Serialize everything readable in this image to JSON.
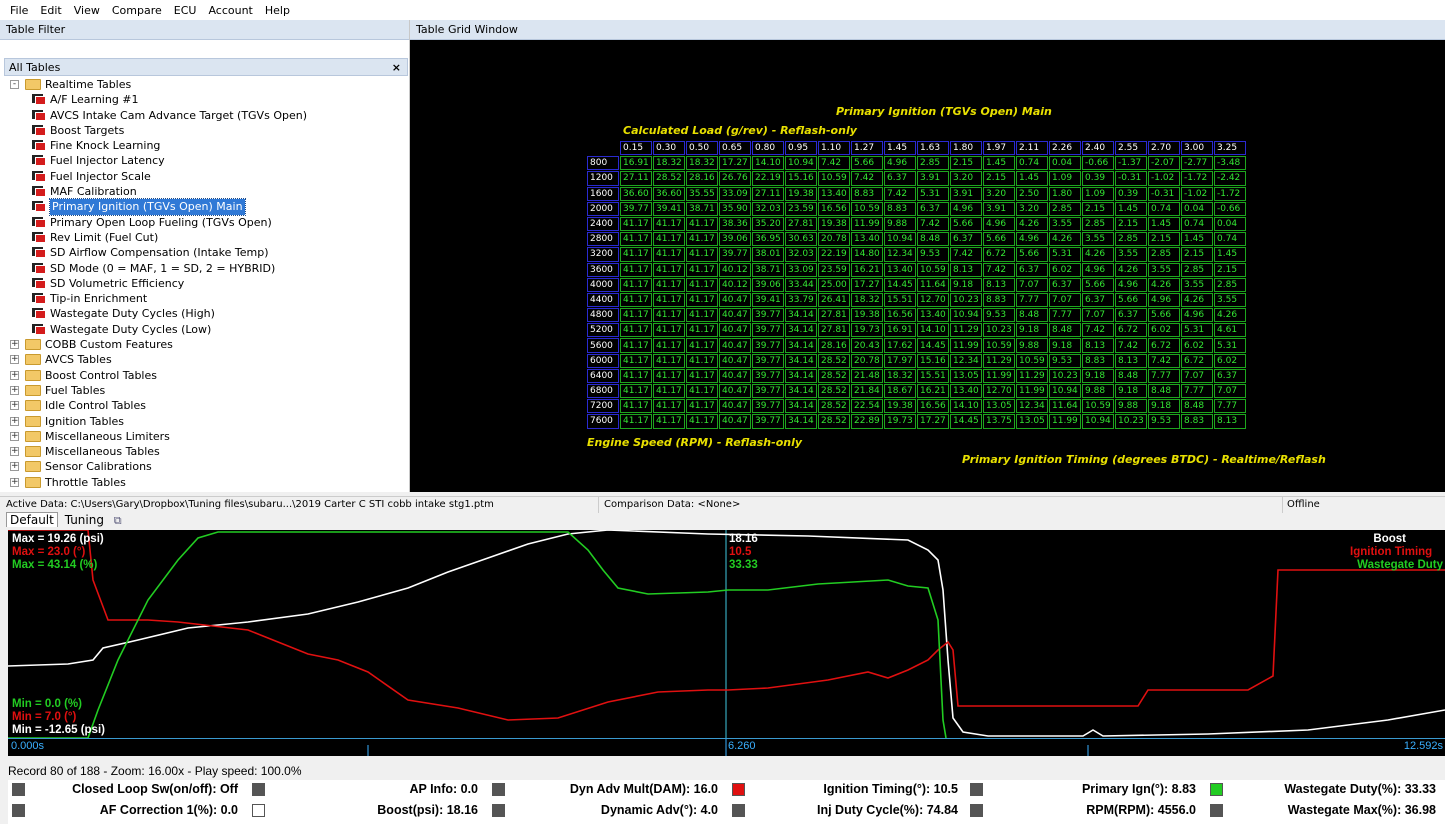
{
  "menu": [
    "File",
    "Edit",
    "View",
    "Compare",
    "ECU",
    "Account",
    "Help"
  ],
  "left_panel": {
    "header": "Table Filter",
    "filter_value": "",
    "all_tables_label": "All Tables",
    "close_symbol": "×"
  },
  "tree": {
    "root_folder": "Realtime Tables",
    "realtime_items": [
      "A/F Learning #1",
      "AVCS Intake Cam Advance Target (TGVs Open)",
      "Boost Targets",
      "Fine Knock Learning",
      "Fuel Injector Latency",
      "Fuel Injector Scale",
      "MAF Calibration",
      "Primary Ignition (TGVs Open) Main",
      "Primary Open Loop Fueling (TGVs Open)",
      "Rev Limit (Fuel Cut)",
      "SD Airflow Compensation (Intake Temp)",
      "SD Mode (0 = MAF, 1 = SD, 2 = HYBRID)",
      "SD Volumetric Efficiency",
      "Tip-in Enrichment",
      "Wastegate Duty Cycles (High)",
      "Wastegate Duty Cycles (Low)"
    ],
    "selected_item": "Primary Ignition (TGVs Open) Main",
    "other_folders": [
      "COBB Custom Features",
      "AVCS Tables",
      "Boost Control Tables",
      "Fuel Tables",
      "Idle Control Tables",
      "Ignition Tables",
      "Miscellaneous Limiters",
      "Miscellaneous Tables",
      "Sensor Calibrations",
      "Throttle Tables"
    ]
  },
  "grid_window": {
    "header": "Table Grid Window",
    "title": "Primary Ignition (TGVs Open) Main",
    "x_axis_label": "Calculated Load (g/rev) - Reflash-only",
    "y_axis_label": "Engine Speed (RPM) - Reflash-only",
    "z_label": "Primary Ignition Timing (degrees BTDC) - Realtime/Reflash",
    "x_headers": [
      "0.15",
      "0.30",
      "0.50",
      "0.65",
      "0.80",
      "0.95",
      "1.10",
      "1.27",
      "1.45",
      "1.63",
      "1.80",
      "1.97",
      "2.11",
      "2.26",
      "2.40",
      "2.55",
      "2.70",
      "3.00",
      "3.25"
    ],
    "rows": [
      {
        "rpm": "800",
        "values": [
          "16.91",
          "18.32",
          "18.32",
          "17.27",
          "14.10",
          "10.94",
          "7.42",
          "5.66",
          "4.96",
          "2.85",
          "2.15",
          "1.45",
          "0.74",
          "0.04",
          "-0.66",
          "-1.37",
          "-2.07",
          "-2.77",
          "-3.48"
        ]
      },
      {
        "rpm": "1200",
        "values": [
          "27.11",
          "28.52",
          "28.16",
          "26.76",
          "22.19",
          "15.16",
          "10.59",
          "7.42",
          "6.37",
          "3.91",
          "3.20",
          "2.15",
          "1.45",
          "1.09",
          "0.39",
          "-0.31",
          "-1.02",
          "-1.72",
          "-2.42"
        ]
      },
      {
        "rpm": "1600",
        "values": [
          "36.60",
          "36.60",
          "35.55",
          "33.09",
          "27.11",
          "19.38",
          "13.40",
          "8.83",
          "7.42",
          "5.31",
          "3.91",
          "3.20",
          "2.50",
          "1.80",
          "1.09",
          "0.39",
          "-0.31",
          "-1.02",
          "-1.72"
        ]
      },
      {
        "rpm": "2000",
        "values": [
          "39.77",
          "39.41",
          "38.71",
          "35.90",
          "32.03",
          "23.59",
          "16.56",
          "10.59",
          "8.83",
          "6.37",
          "4.96",
          "3.91",
          "3.20",
          "2.85",
          "2.15",
          "1.45",
          "0.74",
          "0.04",
          "-0.66"
        ]
      },
      {
        "rpm": "2400",
        "values": [
          "41.17",
          "41.17",
          "41.17",
          "38.36",
          "35.20",
          "27.81",
          "19.38",
          "11.99",
          "9.88",
          "7.42",
          "5.66",
          "4.96",
          "4.26",
          "3.55",
          "2.85",
          "2.15",
          "1.45",
          "0.74",
          "0.04"
        ]
      },
      {
        "rpm": "2800",
        "values": [
          "41.17",
          "41.17",
          "41.17",
          "39.06",
          "36.95",
          "30.63",
          "20.78",
          "13.40",
          "10.94",
          "8.48",
          "6.37",
          "5.66",
          "4.96",
          "4.26",
          "3.55",
          "2.85",
          "2.15",
          "1.45",
          "0.74"
        ]
      },
      {
        "rpm": "3200",
        "values": [
          "41.17",
          "41.17",
          "41.17",
          "39.77",
          "38.01",
          "32.03",
          "22.19",
          "14.80",
          "12.34",
          "9.53",
          "7.42",
          "6.72",
          "5.66",
          "5.31",
          "4.26",
          "3.55",
          "2.85",
          "2.15",
          "1.45"
        ]
      },
      {
        "rpm": "3600",
        "values": [
          "41.17",
          "41.17",
          "41.17",
          "40.12",
          "38.71",
          "33.09",
          "23.59",
          "16.21",
          "13.40",
          "10.59",
          "8.13",
          "7.42",
          "6.37",
          "6.02",
          "4.96",
          "4.26",
          "3.55",
          "2.85",
          "2.15"
        ]
      },
      {
        "rpm": "4000",
        "values": [
          "41.17",
          "41.17",
          "41.17",
          "40.12",
          "39.06",
          "33.44",
          "25.00",
          "17.27",
          "14.45",
          "11.64",
          "9.18",
          "8.13",
          "7.07",
          "6.37",
          "5.66",
          "4.96",
          "4.26",
          "3.55",
          "2.85"
        ]
      },
      {
        "rpm": "4400",
        "values": [
          "41.17",
          "41.17",
          "41.17",
          "40.47",
          "39.41",
          "33.79",
          "26.41",
          "18.32",
          "15.51",
          "12.70",
          "10.23",
          "8.83",
          "7.77",
          "7.07",
          "6.37",
          "5.66",
          "4.96",
          "4.26",
          "3.55"
        ]
      },
      {
        "rpm": "4800",
        "values": [
          "41.17",
          "41.17",
          "41.17",
          "40.47",
          "39.77",
          "34.14",
          "27.81",
          "19.38",
          "16.56",
          "13.40",
          "10.94",
          "9.53",
          "8.48",
          "7.77",
          "7.07",
          "6.37",
          "5.66",
          "4.96",
          "4.26"
        ]
      },
      {
        "rpm": "5200",
        "values": [
          "41.17",
          "41.17",
          "41.17",
          "40.47",
          "39.77",
          "34.14",
          "27.81",
          "19.73",
          "16.91",
          "14.10",
          "11.29",
          "10.23",
          "9.18",
          "8.48",
          "7.42",
          "6.72",
          "6.02",
          "5.31",
          "4.61"
        ]
      },
      {
        "rpm": "5600",
        "values": [
          "41.17",
          "41.17",
          "41.17",
          "40.47",
          "39.77",
          "34.14",
          "28.16",
          "20.43",
          "17.62",
          "14.45",
          "11.99",
          "10.59",
          "9.88",
          "9.18",
          "8.13",
          "7.42",
          "6.72",
          "6.02",
          "5.31"
        ]
      },
      {
        "rpm": "6000",
        "values": [
          "41.17",
          "41.17",
          "41.17",
          "40.47",
          "39.77",
          "34.14",
          "28.52",
          "20.78",
          "17.97",
          "15.16",
          "12.34",
          "11.29",
          "10.59",
          "9.53",
          "8.83",
          "8.13",
          "7.42",
          "6.72",
          "6.02"
        ]
      },
      {
        "rpm": "6400",
        "values": [
          "41.17",
          "41.17",
          "41.17",
          "40.47",
          "39.77",
          "34.14",
          "28.52",
          "21.48",
          "18.32",
          "15.51",
          "13.05",
          "11.99",
          "11.29",
          "10.23",
          "9.18",
          "8.48",
          "7.77",
          "7.07",
          "6.37"
        ]
      },
      {
        "rpm": "6800",
        "values": [
          "41.17",
          "41.17",
          "41.17",
          "40.47",
          "39.77",
          "34.14",
          "28.52",
          "21.84",
          "18.67",
          "16.21",
          "13.40",
          "12.70",
          "11.99",
          "10.94",
          "9.88",
          "9.18",
          "8.48",
          "7.77",
          "7.07"
        ]
      },
      {
        "rpm": "7200",
        "values": [
          "41.17",
          "41.17",
          "41.17",
          "40.47",
          "39.77",
          "34.14",
          "28.52",
          "22.54",
          "19.38",
          "16.56",
          "14.10",
          "13.05",
          "12.34",
          "11.64",
          "10.59",
          "9.88",
          "9.18",
          "8.48",
          "7.77"
        ]
      },
      {
        "rpm": "7600",
        "values": [
          "41.17",
          "41.17",
          "41.17",
          "40.47",
          "39.77",
          "34.14",
          "28.52",
          "22.89",
          "19.73",
          "17.27",
          "14.45",
          "13.75",
          "13.05",
          "11.99",
          "10.94",
          "10.23",
          "9.53",
          "8.83",
          "8.13"
        ]
      }
    ]
  },
  "status": {
    "active_data": "Active Data: C:\\Users\\Gary\\Dropbox\\Tuning files\\subaru...\\2019 Carter C STI cobb intake stg1.ptm",
    "comparison": "Comparison Data: <None>",
    "connection": "Offline"
  },
  "log_tabs": [
    "Default",
    "Tuning"
  ],
  "log_chart": {
    "max_boost": "Max = 19.26 (psi)",
    "max_ign": "Max = 23.0 (°)",
    "max_wg": "Max = 43.14 (%)",
    "min_wg": "Min = 0.0 (%)",
    "min_ign": "Min = 7.0 (°)",
    "min_boost": "Min = -12.65 (psi)",
    "cursor_boost": "18.16",
    "cursor_ign": "10.5",
    "cursor_wg": "33.33",
    "legend_boost": "Boost",
    "legend_ign": "Ignition Timing",
    "legend_wg": "Wastegate Duty",
    "time_start": "0.000s",
    "time_cursor": "6.260",
    "time_end": "12.592s",
    "colors": {
      "boost": "#ffffff",
      "ign": "#e01010",
      "wg": "#22cc22",
      "cursor": "#40c8e0"
    }
  },
  "record_line": "Record 80 of 188 - Zoom: 16.00x - Play speed: 100.0%",
  "params": [
    {
      "label": "Closed Loop Sw(on/off): Off",
      "color": "#555555"
    },
    {
      "label": "AP Info: 0.0",
      "color": "#555555"
    },
    {
      "label": "Dyn Adv Mult(DAM): 16.0",
      "color": "#555555"
    },
    {
      "label": "Ignition Timing(°): 10.5",
      "color": "#e01010"
    },
    {
      "label": "Primary Ign(°): 8.83",
      "color": "#555555"
    },
    {
      "label": "Wastegate Duty(%): 33.33",
      "color": "#22cc22"
    },
    {
      "label": "AF Correction 1(%): 0.0",
      "color": "#555555"
    },
    {
      "label": "Boost(psi): 18.16",
      "color": "#ffffff"
    },
    {
      "label": "Dynamic Adv(°): 4.0",
      "color": "#555555"
    },
    {
      "label": "Inj Duty Cycle(%): 74.84",
      "color": "#555555"
    },
    {
      "label": "RPM(RPM): 4556.0",
      "color": "#555555"
    },
    {
      "label": "Wastegate Max(%): 36.98",
      "color": "#555555"
    }
  ]
}
